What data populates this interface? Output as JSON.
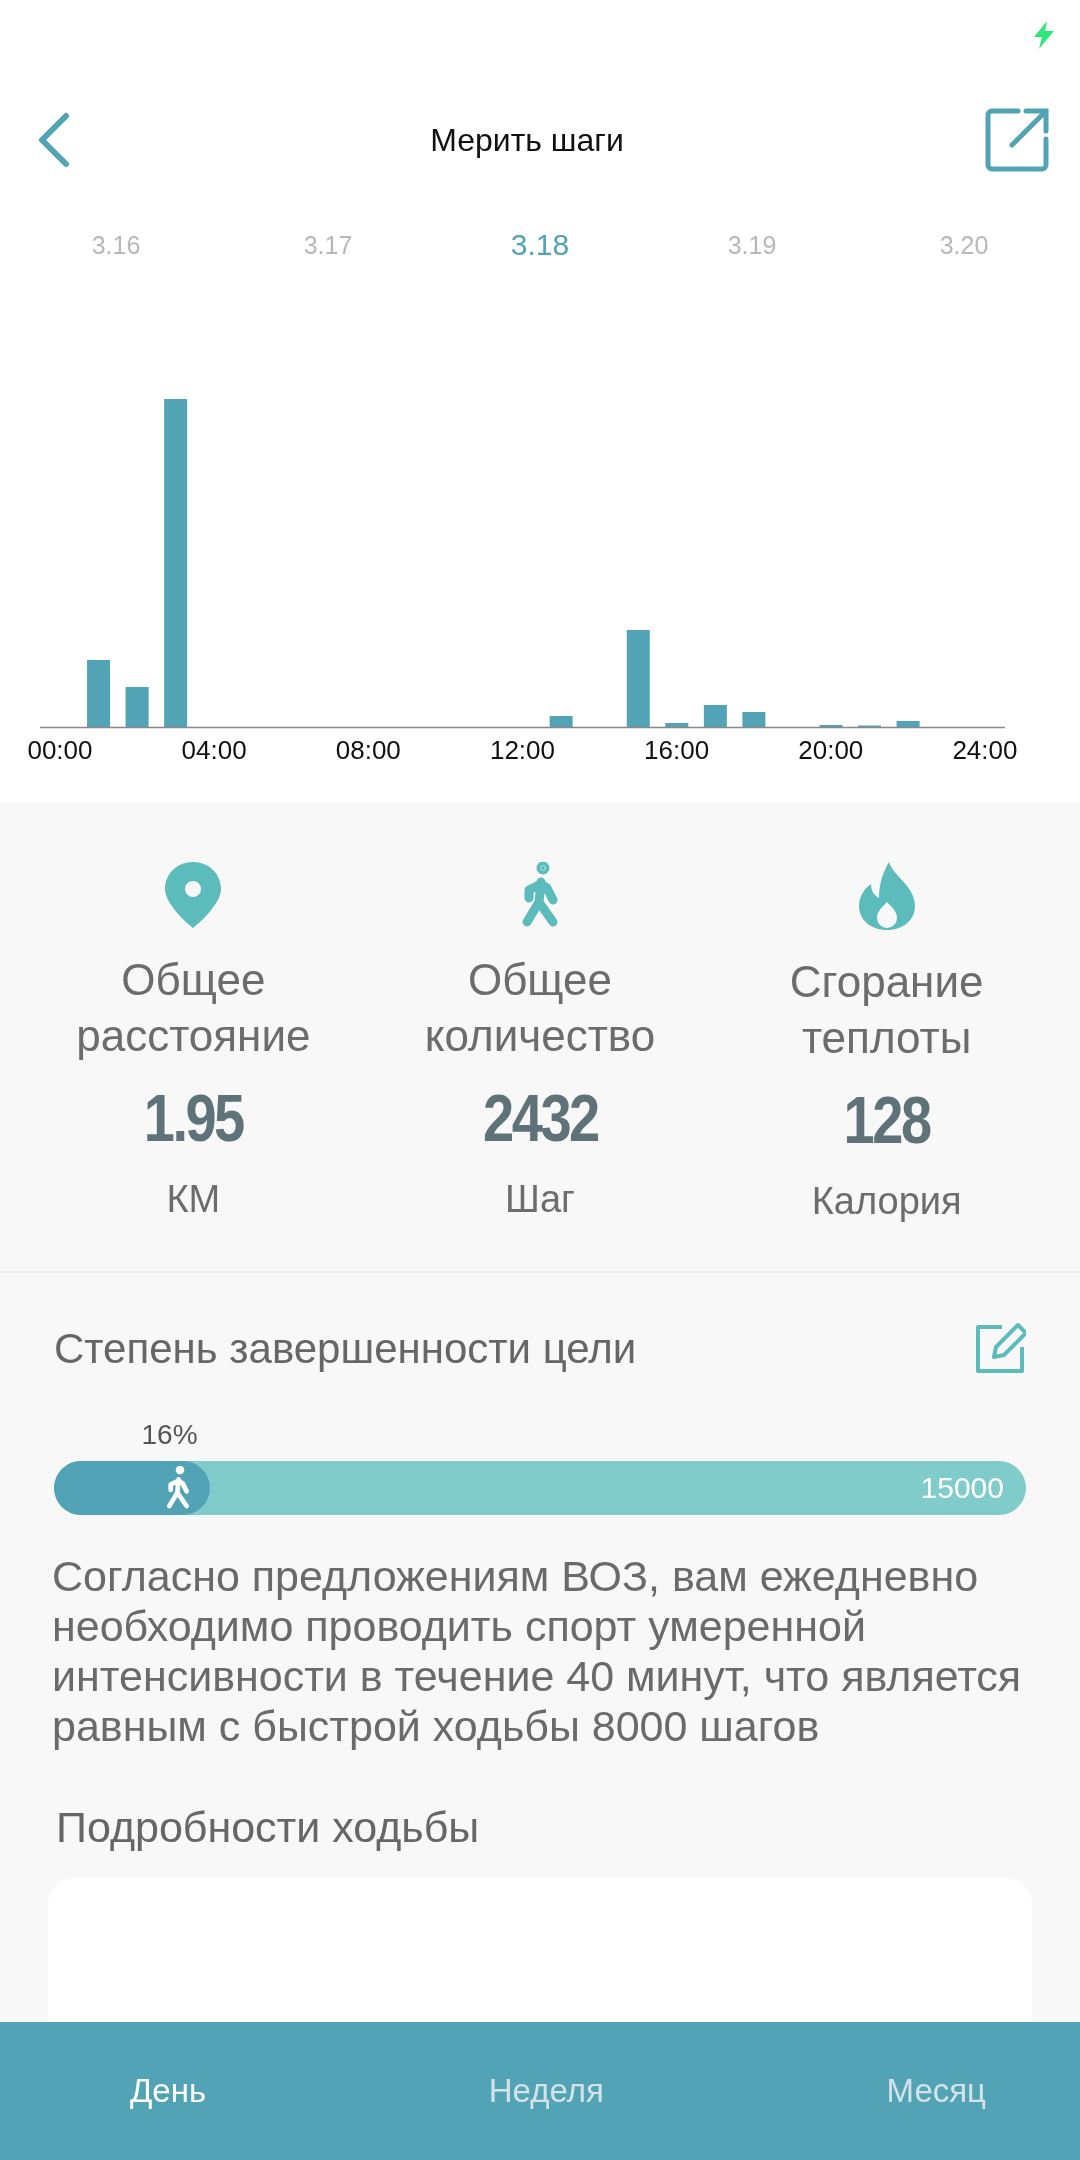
{
  "header": {
    "title": "Мерить шаги"
  },
  "dates": [
    {
      "label": "3.16",
      "selected": false
    },
    {
      "label": "3.17",
      "selected": false
    },
    {
      "label": "3.18",
      "selected": true
    },
    {
      "label": "3.19",
      "selected": false
    },
    {
      "label": "3.20",
      "selected": false
    }
  ],
  "chart": {
    "axis_labels": [
      "00:00",
      "04:00",
      "08:00",
      "12:00",
      "16:00",
      "20:00",
      "24:00"
    ]
  },
  "stats": [
    {
      "kind": "distance",
      "label": "Общее расстояние",
      "value": "1.95",
      "unit": "КМ"
    },
    {
      "kind": "steps",
      "label": "Общее количество",
      "value": "2432",
      "unit": "Шаг"
    },
    {
      "kind": "calories",
      "label": "Сгорание теплоты",
      "value": "128",
      "unit": "Калория"
    }
  ],
  "goal": {
    "title": "Степень завершенности цели",
    "percent": "16%",
    "level": 0.16,
    "target": "15000",
    "note": "Согласно предложениям ВОЗ, вам ежедневно необходимо проводить спорт умеренной интенсивности в течение 40 минут, что является равным с быстрой ходьбы 8000 шагов"
  },
  "details": {
    "title": "Подробности ходьбы"
  },
  "tabs": [
    {
      "label": "День",
      "selected": true
    },
    {
      "label": "Неделя",
      "selected": false
    },
    {
      "label": "Месяц",
      "selected": false
    }
  ]
}
